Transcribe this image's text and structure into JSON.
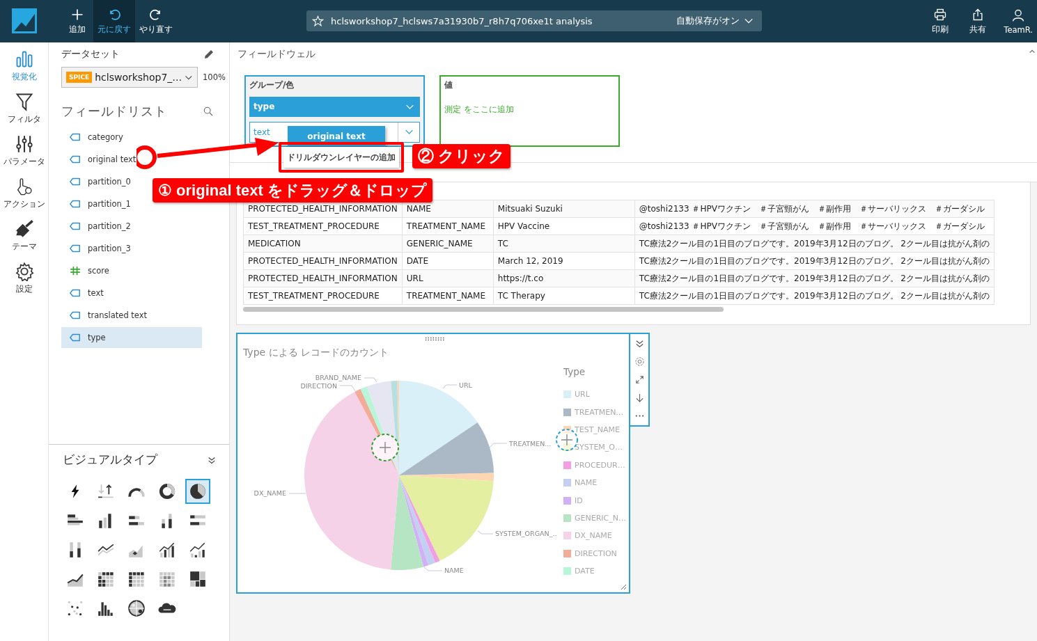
{
  "toolbar": {
    "left_buttons": [
      {
        "label": "追加",
        "kind": "add",
        "selected": false
      },
      {
        "label": "元に戻す",
        "kind": "undo",
        "selected": true
      },
      {
        "label": "やり直す",
        "kind": "redo",
        "selected": false
      }
    ],
    "analysis_title": "hclsworkshop7_hclsws7a31930b7_r8h7q706xe1t analysis",
    "autosave": "自動保存がオン",
    "right_buttons": [
      {
        "label": "印刷",
        "kind": "print"
      },
      {
        "label": "共有",
        "kind": "share"
      },
      {
        "label": "TeamR.",
        "kind": "user"
      }
    ]
  },
  "rail": [
    {
      "label": "視覚化",
      "kind": "visualize",
      "selected": true
    },
    {
      "label": "フィルタ",
      "kind": "filter",
      "selected": false
    },
    {
      "label": "パラメータ",
      "kind": "parameters",
      "selected": false
    },
    {
      "label": "アクション",
      "kind": "actions",
      "selected": false
    },
    {
      "label": "テーマ",
      "kind": "theme",
      "selected": false
    },
    {
      "label": "設定",
      "kind": "settings",
      "selected": false
    }
  ],
  "dataset": {
    "heading": "データセット",
    "badge": "SPICE",
    "name": "hclsworkshop7_…",
    "percent": "100%"
  },
  "field_list": {
    "heading": "フィールドリスト",
    "fields": [
      {
        "name": "category",
        "kind": "dimension",
        "selected": false
      },
      {
        "name": "original text",
        "kind": "dimension",
        "selected": false
      },
      {
        "name": "partition_0",
        "kind": "dimension",
        "selected": false
      },
      {
        "name": "partition_1",
        "kind": "dimension",
        "selected": false
      },
      {
        "name": "partition_2",
        "kind": "dimension",
        "selected": false
      },
      {
        "name": "partition_3",
        "kind": "dimension",
        "selected": false
      },
      {
        "name": "score",
        "kind": "measure",
        "selected": false
      },
      {
        "name": "text",
        "kind": "dimension",
        "selected": false
      },
      {
        "name": "translated text",
        "kind": "dimension",
        "selected": false
      },
      {
        "name": "type",
        "kind": "dimension",
        "selected": true
      }
    ]
  },
  "visual_types": {
    "heading": "ビジュアルタイプ",
    "items": [
      {
        "selected": false
      },
      {
        "selected": false
      },
      {
        "selected": false
      },
      {
        "selected": false
      },
      {
        "selected": true
      },
      {
        "selected": false
      },
      {
        "selected": false
      },
      {
        "selected": false
      },
      {
        "selected": false
      },
      {
        "selected": false
      },
      {
        "selected": false
      },
      {
        "selected": false
      },
      {
        "selected": false
      },
      {
        "selected": false
      },
      {
        "selected": false
      },
      {
        "selected": false
      },
      {
        "selected": false
      },
      {
        "selected": false
      },
      {
        "selected": false
      },
      {
        "selected": false
      },
      {
        "selected": false
      },
      {
        "selected": false
      },
      {
        "selected": false
      },
      {
        "selected": false
      }
    ]
  },
  "field_wells": {
    "heading": "フィールドウェル",
    "group_well": {
      "label": "グループ/色",
      "field": "type",
      "slot": "text"
    },
    "value_well": {
      "label": "値",
      "hint": "測定 をここに追加"
    }
  },
  "dragged_chip": "original text",
  "drill_menu": {
    "item": "ドリルダウンレイヤーの追加"
  },
  "table": {
    "rows": [
      [
        "PROTECTED_HEALTH_INFORMATION",
        "NAME",
        "Mitsuaki Suzuki",
        "@toshi2133 ＃HPVワクチン　＃子宮頸がん　＃副作用　＃サーバリックス　＃ガーダシル"
      ],
      [
        "TEST_TREATMENT_PROCEDURE",
        "TREATMENT_NAME",
        "HPV Vaccine",
        "@toshi2133 ＃HPVワクチン　＃子宮頸がん　＃副作用　＃サーバリックス　＃ガーダシル"
      ],
      [
        "MEDICATION",
        "GENERIC_NAME",
        "TC",
        "TC療法2クール目の1日目のブログです。2019年3月12日のブログ。 2クール目は抗がん剤の"
      ],
      [
        "PROTECTED_HEALTH_INFORMATION",
        "DATE",
        "March 12, 2019",
        "TC療法2クール目の1日目のブログです。2019年3月12日のブログ。 2クール目は抗がん剤の"
      ],
      [
        "PROTECTED_HEALTH_INFORMATION",
        "URL",
        "https://t.co",
        "TC療法2クール目の1日目のブログです。2019年3月12日のブログ。 2クール目は抗がん剤の"
      ],
      [
        "TEST_TREATMENT_PROCEDURE",
        "TREATMENT_NAME",
        "TC Therapy",
        "TC療法2クール目の1日目のブログです。2019年3月12日のブログ。 2クール目は抗がん剤の"
      ]
    ]
  },
  "pie_visual": {
    "title": "Type による レコードのカウント",
    "slice_labels": [
      "BRAND_NAME",
      "DIRECTION",
      "URL",
      "TREATMEN...",
      "DX_NAME",
      "SYSTEM_ORGAN_..",
      "NAME"
    ],
    "legend": {
      "title": "Type",
      "items": [
        {
          "label": "URL",
          "color": "#d9f0f8"
        },
        {
          "label": "TREATMEN…",
          "color": "#abb8c6"
        },
        {
          "label": "TEST_NAME",
          "color": "#fdd7b3"
        },
        {
          "label": "SYSTEM_O…",
          "color": "#e5efa2"
        },
        {
          "label": "PROCEDUR…",
          "color": "#f29ee2"
        },
        {
          "label": "NAME",
          "color": "#c4cff2"
        },
        {
          "label": "ID",
          "color": "#d2b0f5"
        },
        {
          "label": "GENERIC_N…",
          "color": "#b5e5c3"
        },
        {
          "label": "DX_NAME",
          "color": "#f6d2e8"
        },
        {
          "label": "DIRECTION",
          "color": "#f2ac98"
        },
        {
          "label": "DATE",
          "color": "#b7f6d6"
        }
      ]
    }
  },
  "annotations": [
    {
      "kind": "drag",
      "text": "① original text をドラッグ＆ドロップ"
    },
    {
      "kind": "click",
      "text": "② クリック"
    }
  ]
}
